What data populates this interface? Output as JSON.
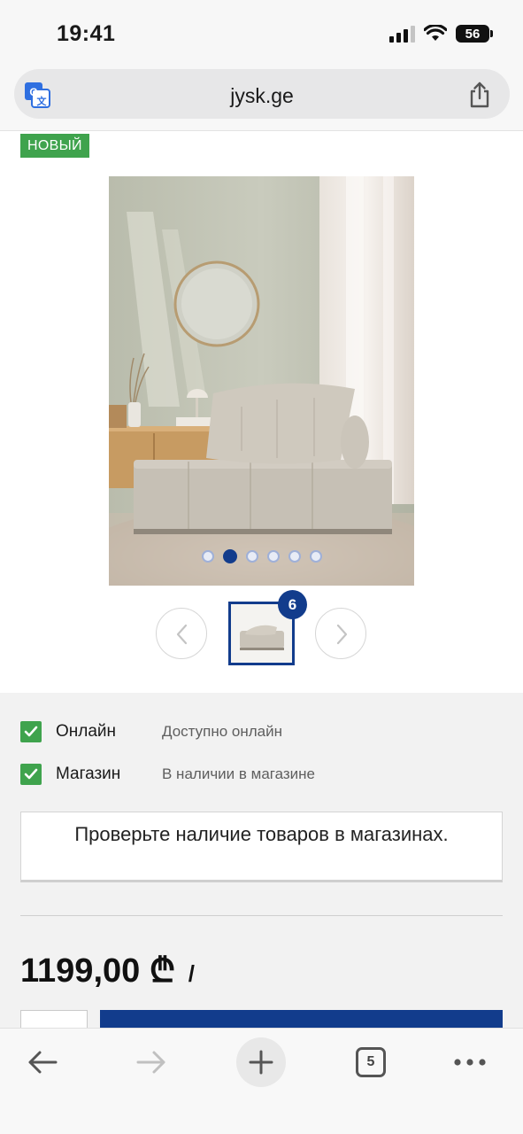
{
  "status_bar": {
    "time": "19:41",
    "battery": "56",
    "signal_icon": "cellular-signal-icon",
    "wifi_icon": "wifi-icon"
  },
  "browser": {
    "url": "jysk.ge",
    "translate_icon": "translate-icon",
    "share_icon": "share-icon"
  },
  "product": {
    "badge": "НОВЫЙ",
    "image_count": 6,
    "active_image_index": 1,
    "thumbnail_badge": "6",
    "price": "1199,00",
    "currency": "₾",
    "price_suffix": "/"
  },
  "availability": [
    {
      "label": "Онлайн",
      "status": "Доступно онлайн"
    },
    {
      "label": "Магазин",
      "status": "В наличии в магазине"
    }
  ],
  "check_stock_button": "Проверьте наличие товаров в магазинах.",
  "toolbar": {
    "back_icon": "back-arrow-icon",
    "forward_icon": "forward-arrow-icon",
    "new_tab_icon": "plus-icon",
    "tabs_count": "5",
    "more_icon": "more-dots-icon"
  },
  "colors": {
    "brand_blue": "#123c8c",
    "badge_green": "#3fa34d",
    "section_bg": "#f2f2f2"
  }
}
